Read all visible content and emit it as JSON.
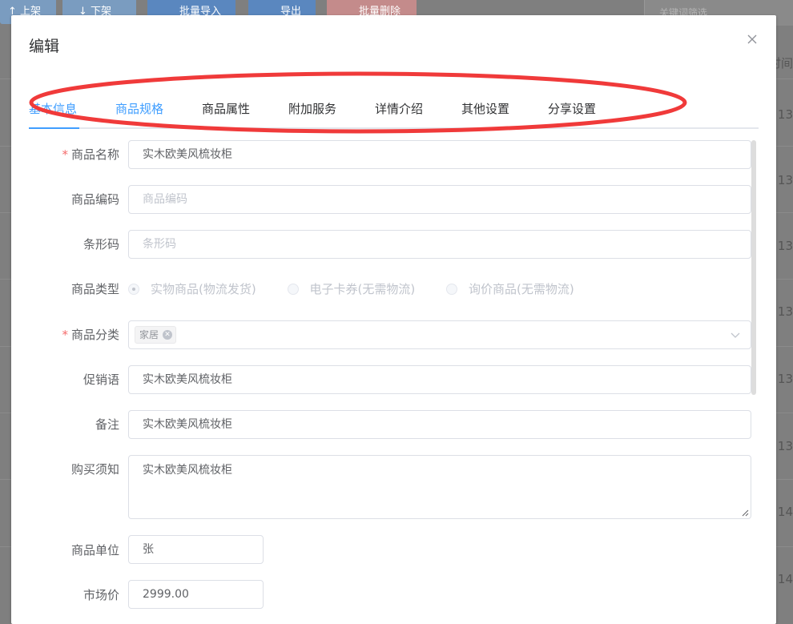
{
  "background": {
    "toolbar": [
      {
        "label": "↑ 上架",
        "color": "#7a9cc0"
      },
      {
        "label": "↓ 下架",
        "color": "#7a9cc0"
      },
      {
        "label": "批量导入",
        "color": "#5a87bf"
      },
      {
        "label": "导出",
        "color": "#5a87bf"
      },
      {
        "label": "批量删除",
        "color": "#c48b8b"
      }
    ],
    "search_placeholder": "关键词筛选",
    "column_header": "时间",
    "row_values": [
      "13",
      "13",
      "13",
      "13",
      "13",
      "13",
      "14",
      "14"
    ]
  },
  "dialog": {
    "title": "编辑",
    "tabs": [
      {
        "label": "基本信息",
        "active": true
      },
      {
        "label": "商品规格",
        "active": false
      },
      {
        "label": "商品属性",
        "active": false
      },
      {
        "label": "附加服务",
        "active": false
      },
      {
        "label": "详情介绍",
        "active": false
      },
      {
        "label": "其他设置",
        "active": false
      },
      {
        "label": "分享设置",
        "active": false
      }
    ],
    "annotation_color": "#f03a3a",
    "fields": {
      "name": {
        "label": "商品名称",
        "required": true,
        "value": "实木欧美风梳妆柜"
      },
      "code": {
        "label": "商品编码",
        "placeholder": "商品编码"
      },
      "barcode": {
        "label": "条形码",
        "placeholder": "条形码"
      },
      "type": {
        "label": "商品类型",
        "options": [
          "实物商品(物流发货)",
          "电子卡券(无需物流)",
          "询价商品(无需物流)"
        ],
        "selected": 0
      },
      "category": {
        "label": "商品分类",
        "required": true,
        "tag": "家居"
      },
      "promo": {
        "label": "促销语",
        "value": "实木欧美风梳妆柜"
      },
      "remark": {
        "label": "备注",
        "value": "实木欧美风梳妆柜"
      },
      "notice": {
        "label": "购买须知",
        "value": "实木欧美风梳妆柜"
      },
      "unit": {
        "label": "商品单位",
        "value": "张"
      },
      "market_price": {
        "label": "市场价",
        "value": "2999.00"
      }
    }
  }
}
